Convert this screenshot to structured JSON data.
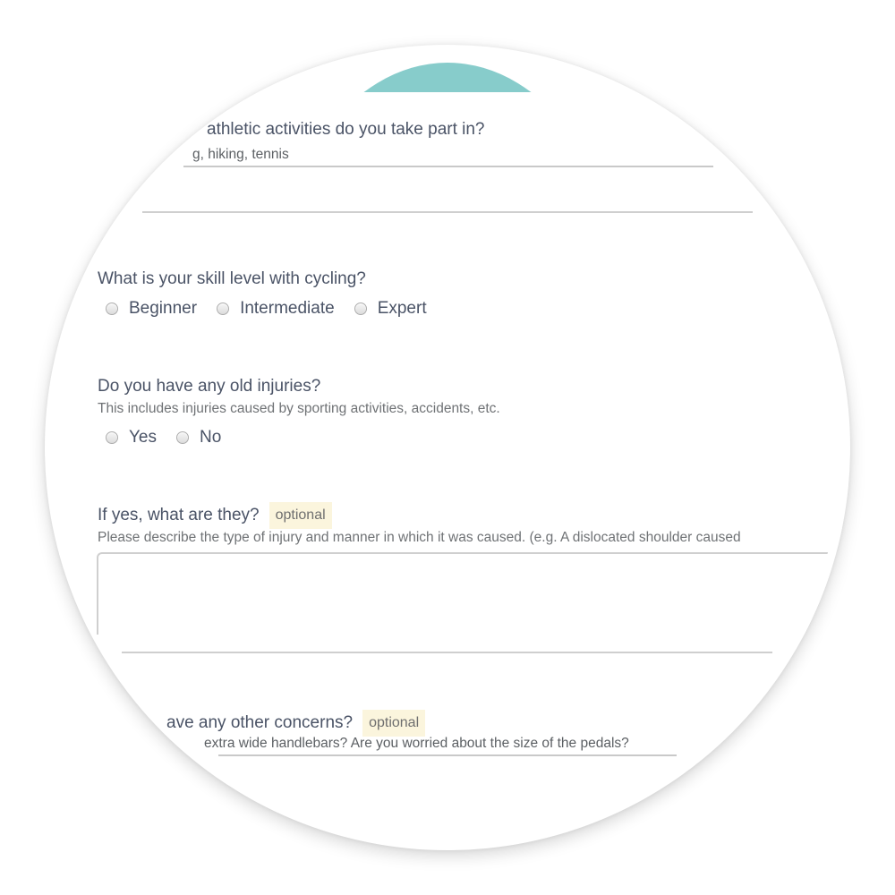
{
  "theme": {
    "accent": "#87cccb",
    "badge_bg": "#fbf5dd"
  },
  "questions": {
    "athletic": {
      "title": "What athletic activities do you take part in?",
      "visible_title": "athletic activities do you take part in?",
      "value": "g, hiking, tennis"
    },
    "skill": {
      "title": "What is your skill level with cycling?",
      "options": [
        "Beginner",
        "Intermediate",
        "Expert"
      ]
    },
    "injuries": {
      "title": "Do you have any old injuries?",
      "help": "This includes injuries caused by sporting activities, accidents, etc.",
      "options": [
        "Yes",
        "No"
      ]
    },
    "injury_details": {
      "title": "If yes, what are they?",
      "badge": "optional",
      "help": "Please describe the type of injury and manner in which it was caused. (e.g. A dislocated shoulder caused",
      "value": ""
    },
    "concerns": {
      "title": "ave any other concerns?",
      "badge": "optional",
      "value": "extra wide handlebars? Are you worried about the size of the pedals?"
    }
  }
}
